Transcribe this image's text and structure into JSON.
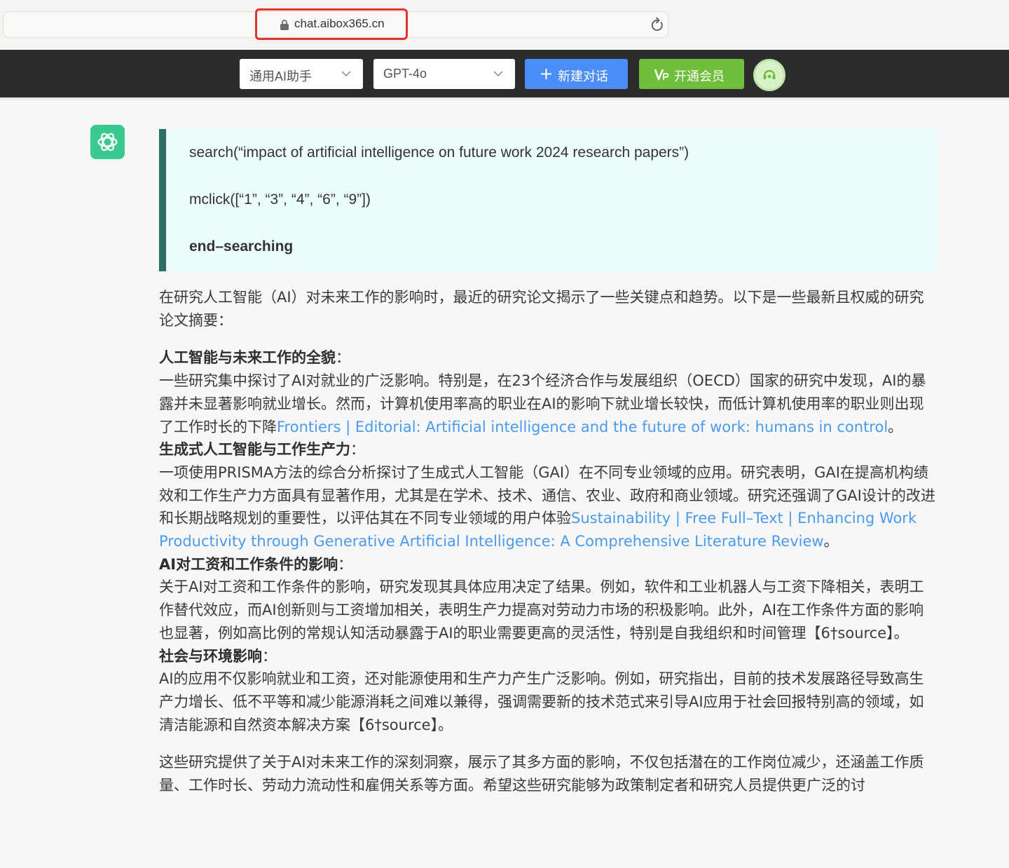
{
  "browser": {
    "url": "chat.aibox365.cn"
  },
  "toolbar": {
    "assistant_select": "通用AI助手",
    "model_select": "GPT-4o",
    "new_chat_label": "新建对话",
    "vip_label": "开通会员"
  },
  "message": {
    "search_block": {
      "line1": "search(“impact of artificial intelligence on future work 2024 research papers”)",
      "line2": "mclick([“1”, “3”, “4”, “6”, “9”])",
      "line3": "end–searching"
    },
    "intro": "在研究人工智能（AI）对未来工作的影响时，最近的研究论文揭示了一些关键点和趋势。以下是一些最新且权威的研究论文摘要：",
    "sections": [
      {
        "heading": "人工智能与未来工作的全貌",
        "heading_suffix": "：",
        "text": "一些研究集中探讨了AI对就业的广泛影响。特别是，在23个经济合作与发展组织（OECD）国家的研究中发现，AI的暴露并未显著影响就业增长。然而，计算机使用率高的职业在AI的影响下就业增长较快，而低计算机使用率的职业则出现了工作时长的下降",
        "link": "Frontiers | Editorial: Artificial intelligence and the future of work: humans in control",
        "tail": "。"
      },
      {
        "heading": "生成式人工智能与工作生产力",
        "heading_suffix": "：",
        "text": "一项使用PRISMA方法的综合分析探讨了生成式人工智能（GAI）在不同专业领域的应用。研究表明，GAI在提高机构绩效和工作生产力方面具有显著作用，尤其是在学术、技术、通信、农业、政府和商业领域。研究还强调了GAI设计的改进和长期战略规划的重要性，以评估其在不同专业领域的用户体验",
        "link": "Sustainability | Free Full–Text | Enhancing Work Productivity through Generative Artificial Intelligence: A Comprehensive Literature Review",
        "tail": "。"
      },
      {
        "heading": "AI对工资和工作条件的影响",
        "heading_suffix": "：",
        "text": "关于AI对工资和工作条件的影响，研究发现其具体应用决定了结果。例如，软件和工业机器人与工资下降相关，表明工作替代效应，而AI创新则与工资增加相关，表明生产力提高对劳动力市场的积极影响。此外，AI在工作条件方面的影响也显著，例如高比例的常规认知活动暴露于AI的职业需要更高的灵活性，特别是自我组织和时间管理【6†source】。",
        "link": "",
        "tail": ""
      },
      {
        "heading": "社会与环境影响",
        "heading_suffix": "：",
        "text": "AI的应用不仅影响就业和工资，还对能源使用和生产力产生广泛影响。例如，研究指出，目前的技术发展路径导致高生产力增长、低不平等和减少能源消耗之间难以兼得，强调需要新的技术范式来引导AI应用于社会回报特别高的领域，如清洁能源和自然资本解决方案【6†source】。",
        "link": "",
        "tail": ""
      }
    ],
    "conclusion": "这些研究提供了关于AI对未来工作的深刻洞察，展示了其多方面的影响，不仅包括潜在的工作岗位减少，还涵盖工作质量、工作时长、劳动力流动性和雇佣关系等方面。希望这些研究能够为政策制定者和研究人员提供更广泛的讨"
  },
  "icons": {
    "lock": "lock-icon",
    "reload": "reload-icon",
    "chevron": "chevron-down-icon",
    "plus": "plus-icon",
    "vip": "vip-icon",
    "support": "support-icon",
    "avatar": "chatgpt-logo-icon"
  },
  "colors": {
    "toolbar_bg": "#2b2c2e",
    "new_chat_bg": "#4c8ef7",
    "vip_bg": "#6fbe3c",
    "link": "#4a9aee",
    "search_block_bg": "#ecfdfd",
    "search_block_border": "#2f6f66",
    "avatar_bg": "#19c37d",
    "url_highlight": "#e0332c"
  }
}
